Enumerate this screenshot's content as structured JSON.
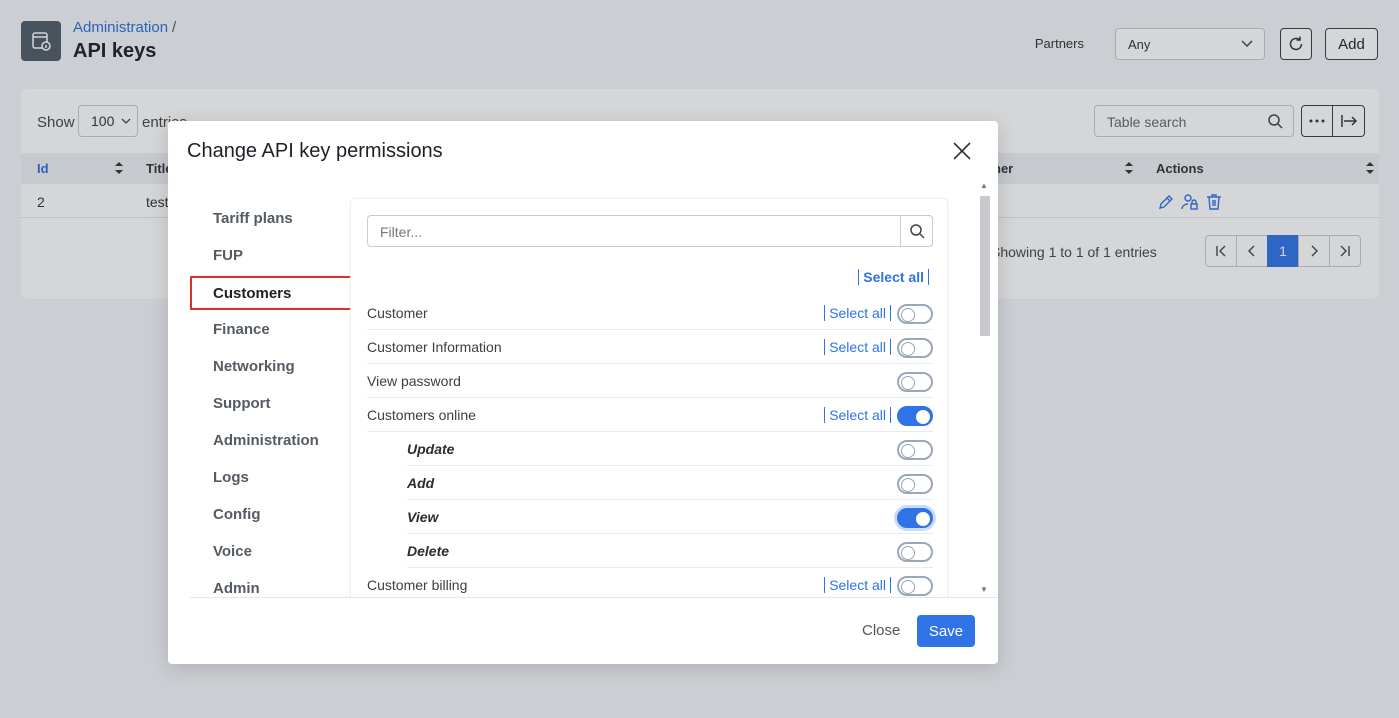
{
  "header": {
    "breadcrumb": "Administration",
    "breadcrumb_sep": "/",
    "title": "API keys",
    "partners_label": "Partners",
    "partners_value": "Any",
    "add_label": "Add"
  },
  "table": {
    "show_label": "Show",
    "page_size": "100",
    "entries_label": "entries",
    "search_placeholder": "Table search",
    "columns": [
      "Id",
      "Title",
      "ner",
      "Actions"
    ],
    "rows": [
      {
        "id": "2",
        "title": "test"
      }
    ],
    "info": "Showing 1 to 1 of 1 entries",
    "current_page": "1"
  },
  "modal": {
    "title": "Change API key permissions",
    "nav": [
      "Tariff plans",
      "FUP",
      "Customers",
      "Finance",
      "Networking",
      "Support",
      "Administration",
      "Logs",
      "Config",
      "Voice",
      "Admin dashboard"
    ],
    "active_nav": "Customers",
    "filter_placeholder": "Filter...",
    "select_all_label": "Select all",
    "permissions": [
      {
        "label": "Customer",
        "select_all": true,
        "on": false,
        "child": false
      },
      {
        "label": "Customer Information",
        "select_all": true,
        "on": false,
        "child": false
      },
      {
        "label": "View password",
        "select_all": false,
        "on": false,
        "child": false
      },
      {
        "label": "Customers online",
        "select_all": true,
        "on": true,
        "child": false
      },
      {
        "label": "Update",
        "select_all": false,
        "on": false,
        "child": true
      },
      {
        "label": "Add",
        "select_all": false,
        "on": false,
        "child": true
      },
      {
        "label": "View",
        "select_all": false,
        "on": true,
        "child": true,
        "focused": true
      },
      {
        "label": "Delete",
        "select_all": false,
        "on": false,
        "child": true
      },
      {
        "label": "Customer billing",
        "select_all": true,
        "on": false,
        "child": false
      }
    ],
    "close_label": "Close",
    "save_label": "Save"
  },
  "colors": {
    "accent": "#2f73e6",
    "highlight": "#d9312b"
  }
}
